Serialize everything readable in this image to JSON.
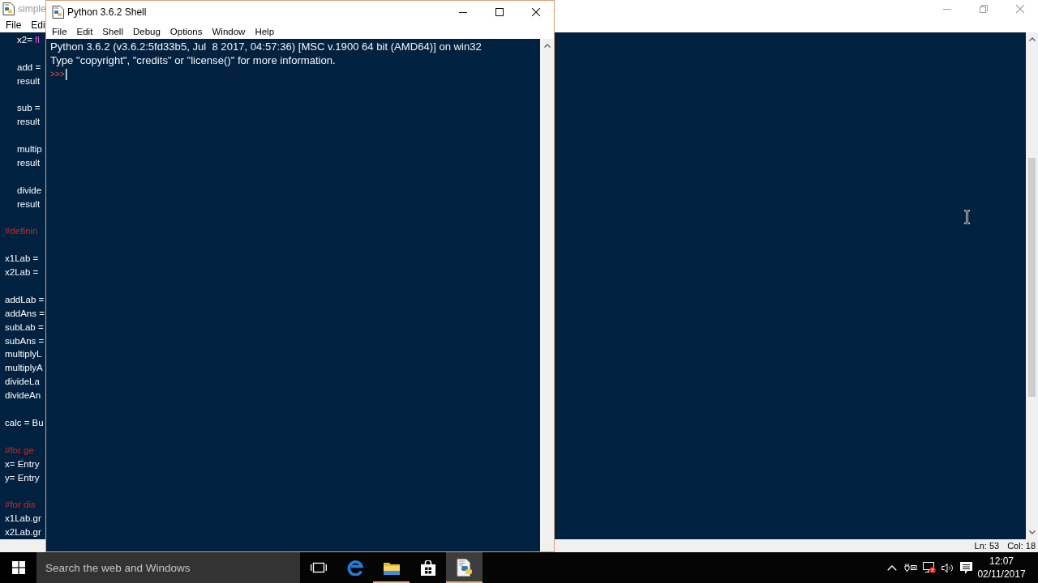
{
  "editor_window": {
    "title": "simple",
    "menu": [
      "File",
      "Edi"
    ],
    "code_blocks": [
      {
        "lines": [
          {
            "kind": "code",
            "indented": true,
            "text": "x2= ",
            "builtin": "fl"
          }
        ]
      },
      {
        "lines": [
          {
            "kind": "code",
            "indented": true,
            "text": "add ="
          },
          {
            "kind": "code",
            "indented": true,
            "text": "result"
          }
        ]
      },
      {
        "lines": [
          {
            "kind": "code",
            "indented": true,
            "text": "sub ="
          },
          {
            "kind": "code",
            "indented": true,
            "text": "result"
          }
        ]
      },
      {
        "lines": [
          {
            "kind": "code",
            "indented": true,
            "text": "multip"
          },
          {
            "kind": "code",
            "indented": true,
            "text": "result"
          }
        ]
      },
      {
        "lines": [
          {
            "kind": "code",
            "indented": true,
            "text": "divide"
          },
          {
            "kind": "code",
            "indented": true,
            "text": "result"
          }
        ]
      },
      {
        "lines": [
          {
            "kind": "comment",
            "indented": false,
            "text": "#definin"
          }
        ]
      },
      {
        "lines": [
          {
            "kind": "code",
            "indented": false,
            "text": "x1Lab ="
          },
          {
            "kind": "code",
            "indented": false,
            "text": "x2Lab ="
          }
        ]
      },
      {
        "lines": [
          {
            "kind": "code",
            "indented": false,
            "text": "addLab ="
          },
          {
            "kind": "code",
            "indented": false,
            "text": "addAns ="
          },
          {
            "kind": "code",
            "indented": false,
            "text": "subLab ="
          },
          {
            "kind": "code",
            "indented": false,
            "text": "subAns ="
          },
          {
            "kind": "code",
            "indented": false,
            "text": "multiplyL"
          },
          {
            "kind": "code",
            "indented": false,
            "text": "multiplyA"
          },
          {
            "kind": "code",
            "indented": false,
            "text": "divideLa"
          },
          {
            "kind": "code",
            "indented": false,
            "text": "divideAn"
          }
        ]
      },
      {
        "lines": [
          {
            "kind": "code",
            "indented": false,
            "text": "calc = Bu"
          }
        ]
      },
      {
        "lines": [
          {
            "kind": "comment",
            "indented": false,
            "text": "#for ge"
          },
          {
            "kind": "code",
            "indented": false,
            "text": "x= Entry"
          },
          {
            "kind": "code",
            "indented": false,
            "text": "y= Entry"
          }
        ]
      },
      {
        "lines": [
          {
            "kind": "comment",
            "indented": false,
            "text": "#for dis"
          },
          {
            "kind": "code",
            "indented": false,
            "text": "x1Lab.gr"
          },
          {
            "kind": "code",
            "indented": false,
            "text": "x2Lab.gr"
          }
        ]
      }
    ],
    "status_bar": {
      "line": "Ln: 53",
      "column": "Col: 18"
    }
  },
  "shell_window": {
    "title": "Python 3.6.2 Shell",
    "menu": [
      "File",
      "Edit",
      "Shell",
      "Debug",
      "Options",
      "Window",
      "Help"
    ],
    "output_lines": [
      "Python 3.6.2 (v3.6.2:5fd33b5, Jul  8 2017, 04:57:36) [MSC v.1900 64 bit (AMD64)] on win32",
      "Type \"copyright\", \"credits\" or \"license()\" for more information."
    ],
    "prompt": ">>>"
  },
  "taskbar": {
    "search": {
      "placeholder": "Search the web and Windows"
    },
    "apps": [
      {
        "kind": "task-view",
        "running": false,
        "selected": false
      },
      {
        "kind": "browser",
        "running": false,
        "selected": false
      },
      {
        "kind": "file-manager",
        "running": true,
        "selected": false
      },
      {
        "kind": "store",
        "running": false,
        "selected": false
      },
      {
        "kind": "python-shell",
        "running": true,
        "selected": true
      }
    ],
    "clock": {
      "time": "12:07",
      "date": "02/11/2017"
    }
  }
}
